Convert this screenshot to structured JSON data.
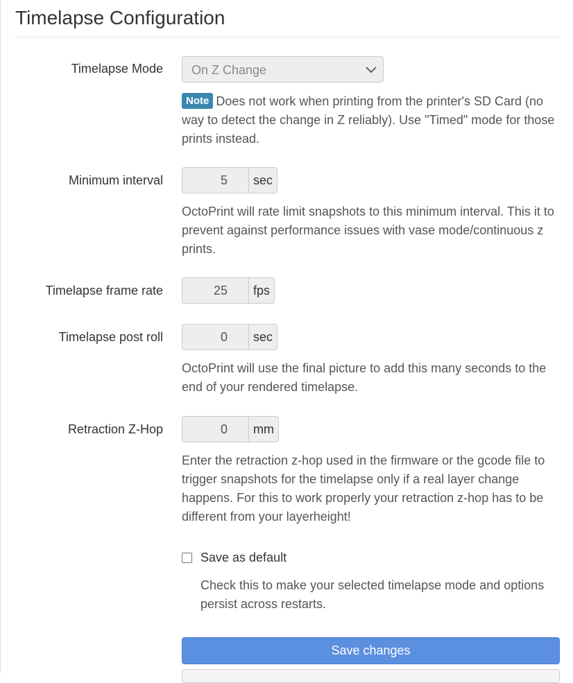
{
  "page": {
    "title": "Timelapse Configuration"
  },
  "mode": {
    "label": "Timelapse Mode",
    "selected": "On Z Change",
    "note_badge": "Note",
    "note_text": "Does not work when printing from the printer's SD Card (no way to detect the change in Z reliably). Use \"Timed\" mode for those prints instead."
  },
  "min_interval": {
    "label": "Minimum interval",
    "value": "5",
    "unit": "sec",
    "help": "OctoPrint will rate limit snapshots to this minimum interval. This it to prevent against performance issues with vase mode/continuous z prints."
  },
  "frame_rate": {
    "label": "Timelapse frame rate",
    "value": "25",
    "unit": "fps"
  },
  "post_roll": {
    "label": "Timelapse post roll",
    "value": "0",
    "unit": "sec",
    "help": "OctoPrint will use the final picture to add this many seconds to the end of your rendered timelapse."
  },
  "zhop": {
    "label": "Retraction Z-Hop",
    "value": "0",
    "unit": "mm",
    "help": "Enter the retraction z-hop used in the firmware or the gcode file to trigger snapshots for the timelapse only if a real layer change happens. For this to work properly your retraction z-hop has to be different from your layerheight!"
  },
  "save_default": {
    "label": "Save as default",
    "checked": false,
    "help": "Check this to make your selected timelapse mode and options persist across restarts."
  },
  "buttons": {
    "save": "Save changes"
  },
  "colors": {
    "accent": "#5b8fe0",
    "note_badge": "#3a87ad"
  },
  "icons": {
    "select_chevron": "chevron-down-icon"
  }
}
